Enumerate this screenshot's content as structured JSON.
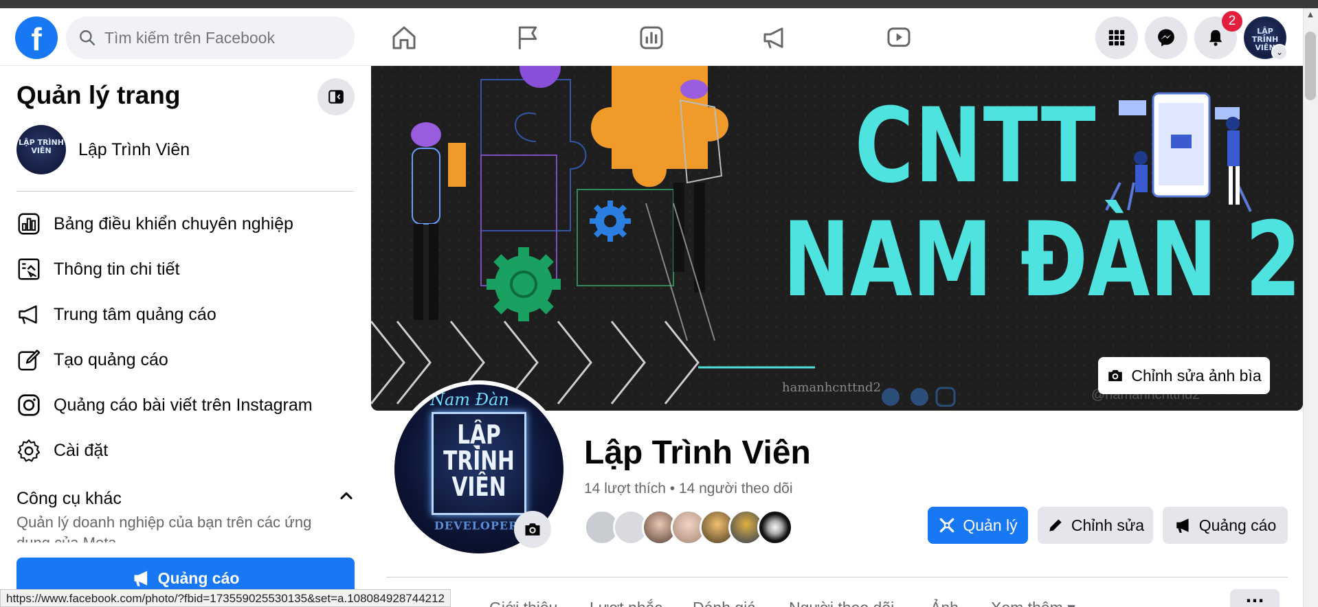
{
  "header": {
    "logo": "f",
    "search_placeholder": "Tìm kiếm trên Facebook",
    "nav_icons": [
      "home-icon",
      "flag-icon",
      "insights-icon",
      "megaphone-icon",
      "video-icon"
    ],
    "right_icons": [
      "menu-grid-icon",
      "messenger-icon",
      "bell-icon"
    ],
    "notification_count": "2",
    "avatar_text": "LẬP TRÌNH VIÊN"
  },
  "sidebar": {
    "title": "Quản lý trang",
    "page_name": "Lập Trình Viên",
    "page_avatar_text": "LẬP TRÌNH VIÊN",
    "items": [
      {
        "label": "Bảng điều khiển chuyên nghiệp",
        "icon": "dashboard-icon"
      },
      {
        "label": "Thông tin chi tiết",
        "icon": "insights-icon"
      },
      {
        "label": "Trung tâm quảng cáo",
        "icon": "megaphone-icon"
      },
      {
        "label": "Tạo quảng cáo",
        "icon": "edit-icon"
      },
      {
        "label": "Quảng cáo bài viết trên Instagram",
        "icon": "instagram-icon"
      },
      {
        "label": "Cài đặt",
        "icon": "gear-icon"
      }
    ],
    "section_title": "Công cụ khác",
    "section_desc": "Quản lý doanh nghiệp của bạn trên các ứng dụng của Meta",
    "ad_button": "Quảng cáo"
  },
  "cover": {
    "line1": "CNTT",
    "line2": "NAM ĐÀN 2",
    "handle_left": "hamanhcnttnd2",
    "handle_right": "@hamanhcnttnd2",
    "edit_button": "Chỉnh sửa ảnh bìa",
    "text_color": "#4fe3e0"
  },
  "profile": {
    "pic_script": "Nam Đàn",
    "pic_title": "LẬP TRÌNH VIÊN",
    "pic_dev": "DEVELOPER",
    "name": "Lập Trình Viên",
    "stats": "14 lượt thích • 14 người theo dõi",
    "follower_count_shown": 7,
    "buttons": {
      "manage": "Quản lý",
      "edit": "Chỉnh sửa",
      "promote": "Quảng cáo"
    }
  },
  "tabs": [
    "Giới thiệu",
    "Lượt nhắc",
    "Đánh giá",
    "Người theo dõi",
    "Ảnh",
    "Xem thêm ▾"
  ],
  "more_button": "···",
  "status_bar": {
    "url": "https://www.facebook.com/photo/?fbid=173559025530135&set=a.108084928744212"
  },
  "colors": {
    "brand": "#1877f2",
    "badge": "#e41e3f",
    "cover_bg": "#1e1e1e"
  }
}
